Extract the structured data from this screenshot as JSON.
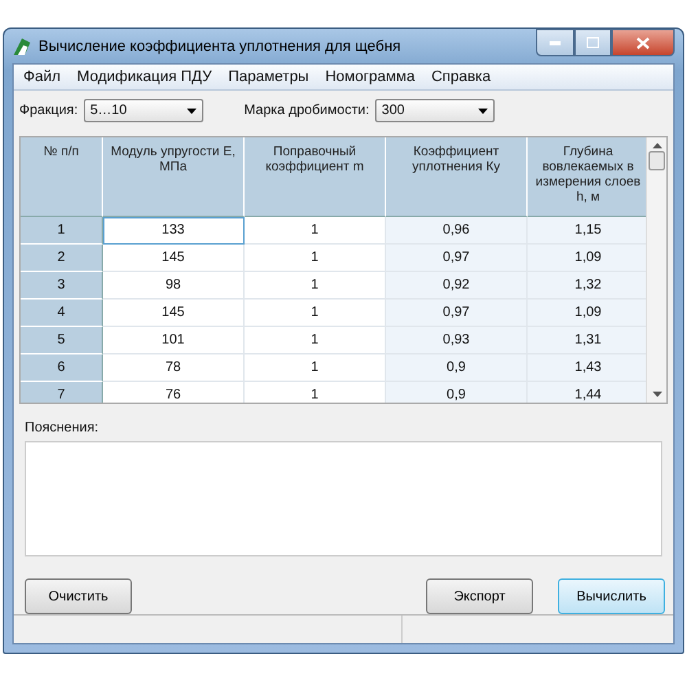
{
  "window": {
    "title": "Вычисление коэффициента уплотнения для щебня"
  },
  "menu": [
    "Файл",
    "Модификация ПДУ",
    "Параметры",
    "Номограмма",
    "Справка"
  ],
  "filters": [
    {
      "label": "Фракция:",
      "value": "5…10"
    },
    {
      "label": "Марка дробимости:",
      "value": "300"
    }
  ],
  "table": {
    "columns": [
      {
        "label": "№ п/п"
      },
      {
        "label": "Модуль упругости E, МПа",
        "editable": true
      },
      {
        "label": "Поправочный коэффициент m",
        "editable": true
      },
      {
        "label": "Коэффициент уплотнения Ку",
        "editable": false
      },
      {
        "label": "Глубина вовлекаемых в измерения слоев h, м",
        "editable": false
      }
    ],
    "rows": [
      {
        "cells": [
          "1",
          "133",
          "1",
          "0,96",
          "1,15"
        ],
        "focused": true
      },
      {
        "cells": [
          "2",
          "145",
          "1",
          "0,97",
          "1,09"
        ],
        "focused": false
      },
      {
        "cells": [
          "3",
          "98",
          "1",
          "0,92",
          "1,32"
        ],
        "focused": false
      },
      {
        "cells": [
          "4",
          "145",
          "1",
          "0,97",
          "1,09"
        ],
        "focused": false
      },
      {
        "cells": [
          "5",
          "101",
          "1",
          "0,93",
          "1,31"
        ],
        "focused": false
      },
      {
        "cells": [
          "6",
          "78",
          "1",
          "0,9",
          "1,43"
        ],
        "focused": false
      },
      {
        "cells": [
          "7",
          "76",
          "1",
          "0,9",
          "1,44"
        ],
        "focused": false
      }
    ]
  },
  "notes": {
    "label": "Пояснения:"
  },
  "left_buttons": [
    {
      "label": "Очистить",
      "default": false
    }
  ],
  "right_buttons": [
    {
      "label": "Экспорт",
      "default": false
    },
    {
      "label": "Вычислить",
      "default": true
    }
  ]
}
